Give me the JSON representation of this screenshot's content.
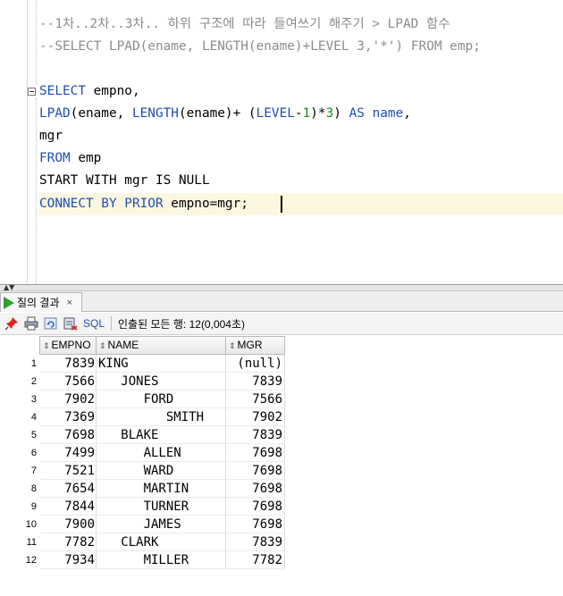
{
  "editor": {
    "lines": [
      "--1차..2차..3차.. 하위 구조에 따라 들여쓰기 해주기 > LPAD 함수",
      "--SELECT LPAD(ename, LENGTH(ename)+LEVEL 3,'*') FROM emp;",
      "",
      "SELECT empno,",
      "LPAD(ename, LENGTH(ename)+ (LEVEL-1)*3) AS name,",
      "mgr",
      "FROM emp",
      "START WITH mgr IS NULL",
      "CONNECT BY PRIOR empno=mgr;"
    ],
    "tokens": {
      "select": "SELECT",
      "select_rest": " empno,",
      "lpad": "LPAD",
      "lpad_args": "(ename, ",
      "length": "LENGTH",
      "length_args": "(ename)+ (",
      "level": "LEVEL",
      "minus": "-",
      "one": "1",
      "times": ")*",
      "three": "3",
      "close": ") ",
      "as": "AS",
      "space": " ",
      "name_kw": "name",
      "comma": ",",
      "mgr": "mgr",
      "from": "FROM",
      "from_rest": " emp",
      "start_with": "START WITH mgr IS NULL",
      "connect_by_prior": "CONNECT BY PRIOR",
      "connect_rest": " empno=mgr;"
    }
  },
  "results": {
    "tab_label": "질의 결과",
    "tab_close": "×",
    "toolbar": {
      "sql_label": "SQL",
      "status": "인출된 모든 행: 12(0,004초)"
    },
    "columns": [
      "EMPNO",
      "NAME",
      "MGR"
    ],
    "rows": [
      {
        "n": "1",
        "empno": "7839",
        "name": "KING",
        "mgr": "(null)"
      },
      {
        "n": "2",
        "empno": "7566",
        "name": "   JONES",
        "mgr": "7839"
      },
      {
        "n": "3",
        "empno": "7902",
        "name": "      FORD",
        "mgr": "7566"
      },
      {
        "n": "4",
        "empno": "7369",
        "name": "         SMITH",
        "mgr": "7902"
      },
      {
        "n": "5",
        "empno": "7698",
        "name": "   BLAKE",
        "mgr": "7839"
      },
      {
        "n": "6",
        "empno": "7499",
        "name": "      ALLEN",
        "mgr": "7698"
      },
      {
        "n": "7",
        "empno": "7521",
        "name": "      WARD",
        "mgr": "7698"
      },
      {
        "n": "8",
        "empno": "7654",
        "name": "      MARTIN",
        "mgr": "7698"
      },
      {
        "n": "9",
        "empno": "7844",
        "name": "      TURNER",
        "mgr": "7698"
      },
      {
        "n": "10",
        "empno": "7900",
        "name": "      JAMES",
        "mgr": "7698"
      },
      {
        "n": "11",
        "empno": "7782",
        "name": "   CLARK",
        "mgr": "7839"
      },
      {
        "n": "12",
        "empno": "7934",
        "name": "      MILLER",
        "mgr": "7782"
      }
    ]
  },
  "icons": [
    "pin-icon",
    "print-icon",
    "refresh-icon",
    "export-icon",
    "run-icon",
    "sort-icon"
  ]
}
